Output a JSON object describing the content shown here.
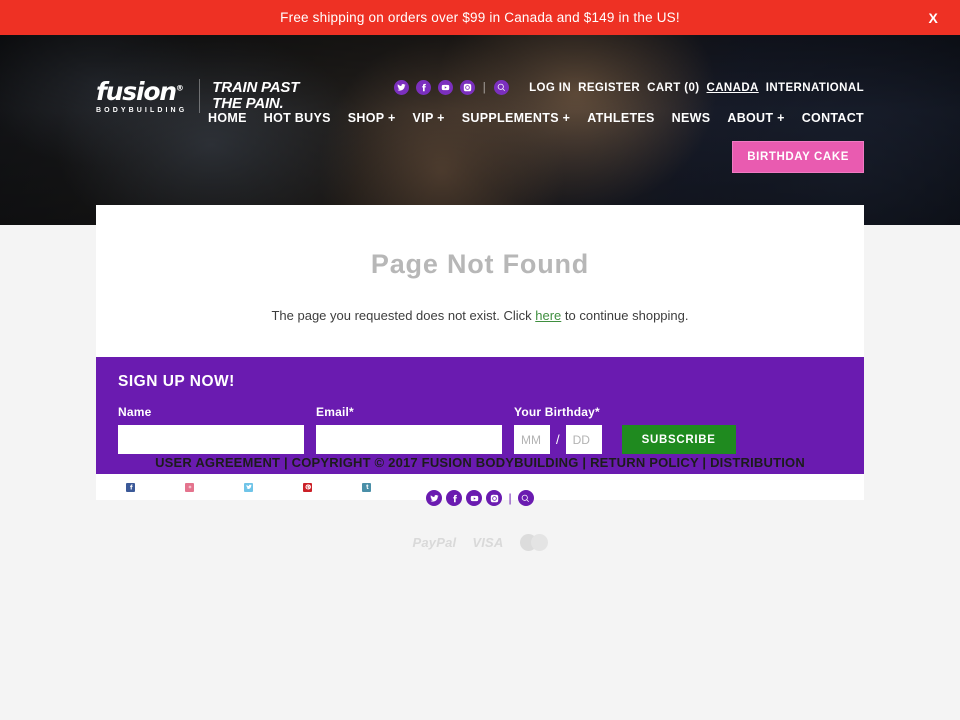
{
  "announcement": {
    "text": "Free shipping on orders over $99 in Canada and $149 in the US!",
    "close_label": "X",
    "bg_color": "#ee3124"
  },
  "header": {
    "logo": {
      "word": "fusion",
      "registered": "®",
      "subtitle": "BODYBUILDING",
      "tagline_line1": "TRAIN PAST",
      "tagline_line2": "THE PAIN."
    },
    "utility_nav": {
      "social": [
        {
          "name": "twitter-icon",
          "label": "Twitter"
        },
        {
          "name": "facebook-icon",
          "label": "Facebook"
        },
        {
          "name": "youtube-icon",
          "label": "YouTube"
        },
        {
          "name": "instagram-icon",
          "label": "Instagram"
        }
      ],
      "separator": "|",
      "search_label": "Search",
      "links": [
        {
          "label": "LOG IN",
          "underline": false
        },
        {
          "label": "REGISTER",
          "underline": false
        },
        {
          "label": "CART (0)",
          "underline": false
        },
        {
          "label": "CANADA",
          "underline": true
        },
        {
          "label": "INTERNATIONAL",
          "underline": false
        }
      ]
    },
    "main_nav": [
      {
        "label": "HOME",
        "has_plus": false
      },
      {
        "label": "HOT BUYS",
        "has_plus": false
      },
      {
        "label": "SHOP",
        "has_plus": true
      },
      {
        "label": "VIP",
        "has_plus": true
      },
      {
        "label": "SUPPLEMENTS",
        "has_plus": true
      },
      {
        "label": "ATHLETES",
        "has_plus": false
      },
      {
        "label": "NEWS",
        "has_plus": false
      },
      {
        "label": "ABOUT",
        "has_plus": true
      },
      {
        "label": "CONTACT",
        "has_plus": false
      }
    ],
    "promo_button": {
      "label": "BIRTHDAY CAKE",
      "color": "#e95bb0"
    }
  },
  "main": {
    "title": "Page Not Found",
    "message_before": "The page you requested does not exist. Click ",
    "message_link": "here",
    "message_after": " to continue shopping."
  },
  "signup": {
    "title": "SIGN UP NOW!",
    "bg_color": "#6a1bb0",
    "name_label": "Name",
    "name_value": "",
    "name_placeholder": "",
    "email_label": "Email*",
    "email_value": "",
    "email_placeholder": "",
    "birthday_label": "Your Birthday*",
    "birthday_month_placeholder": "MM",
    "birthday_month_value": "",
    "birthday_separator": "/",
    "birthday_day_placeholder": "DD",
    "birthday_day_value": "",
    "subscribe_label": "SUBSCRIBE",
    "subscribe_color": "#1f8a1f"
  },
  "share_bar": {
    "items": [
      {
        "name": "facebook-share-icon",
        "color": "#3b5998"
      },
      {
        "name": "instagram-share-icon",
        "color": "#e4738d"
      },
      {
        "name": "twitter-share-icon",
        "color": "#6fc4e8"
      },
      {
        "name": "pinterest-share-icon",
        "color": "#cb2027"
      },
      {
        "name": "tumblr-share-icon",
        "color": "#4a8fa8"
      }
    ]
  },
  "footer": {
    "links": [
      "USER AGREEMENT",
      "COPYRIGHT © 2017 FUSION BODYBUILDING",
      "RETURN POLICY",
      "DISTRIBUTION"
    ],
    "separator": "|",
    "social": [
      {
        "name": "twitter-icon",
        "label": "Twitter"
      },
      {
        "name": "facebook-icon",
        "label": "Facebook"
      },
      {
        "name": "youtube-icon",
        "label": "YouTube"
      },
      {
        "name": "instagram-icon",
        "label": "Instagram"
      }
    ],
    "social_separator": "|",
    "search_label": "Search",
    "payments": [
      {
        "name": "paypal-logo",
        "label": "PayPal"
      },
      {
        "name": "visa-logo",
        "label": "VISA"
      },
      {
        "name": "mastercard-logo",
        "label": ""
      }
    ]
  }
}
